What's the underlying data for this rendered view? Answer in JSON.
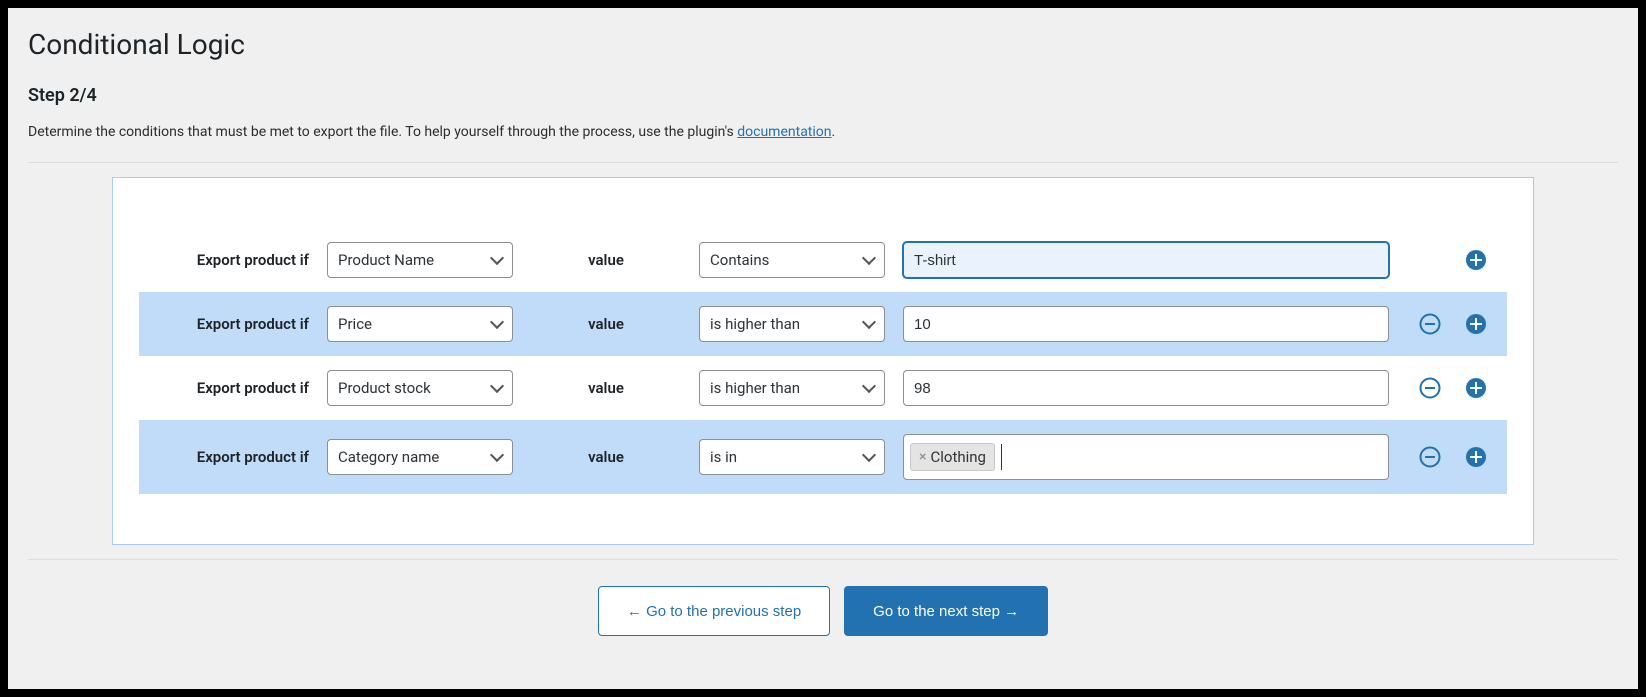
{
  "title": "Conditional Logic",
  "step_label": "Step 2/4",
  "description_prefix": "Determine the conditions that must be met to export the file. To help yourself through the process, use the plugin's ",
  "description_link": "documentation",
  "description_suffix": ".",
  "rows": [
    {
      "label": "Export product if",
      "field": "Product Name",
      "value_label": "value",
      "operator": "Contains",
      "value": "T-shirt",
      "show_remove": false,
      "focused": true,
      "tag_mode": false
    },
    {
      "label": "Export product if",
      "field": "Price",
      "value_label": "value",
      "operator": "is higher than",
      "value": "10",
      "show_remove": true,
      "focused": false,
      "tag_mode": false
    },
    {
      "label": "Export product if",
      "field": "Product stock",
      "value_label": "value",
      "operator": "is higher than",
      "value": "98",
      "show_remove": true,
      "focused": false,
      "tag_mode": false
    },
    {
      "label": "Export product if",
      "field": "Category name",
      "value_label": "value",
      "operator": "is in",
      "value": "",
      "tags": [
        "Clothing"
      ],
      "show_remove": true,
      "focused": false,
      "tag_mode": true
    }
  ],
  "buttons": {
    "prev": "← Go to the previous step",
    "next": "Go to the next step →"
  },
  "colors": {
    "accent": "#2271b1",
    "row_alt": "#c1dcf8"
  }
}
